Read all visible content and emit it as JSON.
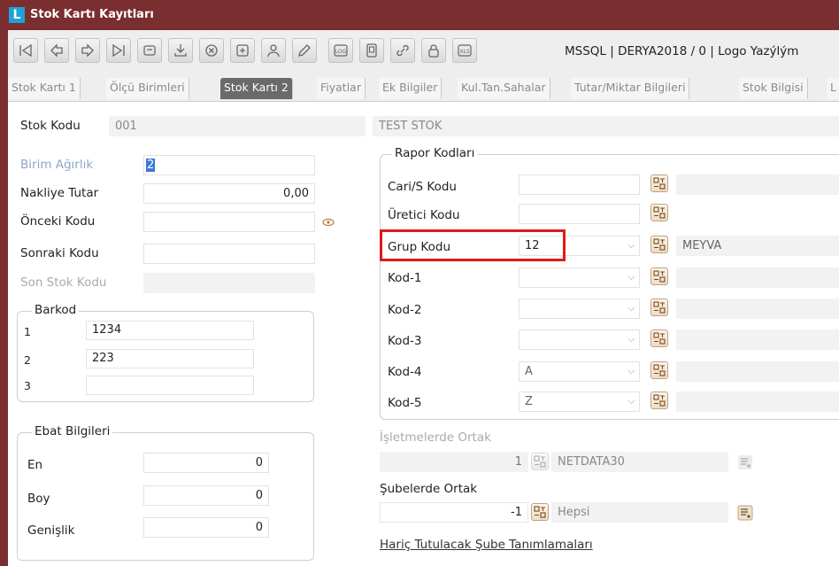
{
  "window": {
    "app_logo": "L",
    "title": "Stok Kartı Kayıtları"
  },
  "toolbar": {
    "connection_info": "MSSQL | DERYA2018 / 0 | Logo Yazýlým",
    "buttons": [
      {
        "icon": "first-record-icon"
      },
      {
        "icon": "previous-record-icon"
      },
      {
        "icon": "next-record-icon"
      },
      {
        "icon": "last-record-icon"
      },
      {
        "icon": "folder-icon"
      },
      {
        "icon": "download-icon"
      },
      {
        "icon": "delete-icon"
      },
      {
        "icon": "new-record-icon"
      },
      {
        "icon": "user-icon"
      },
      {
        "icon": "edit-icon"
      },
      {
        "icon": "log-icon",
        "label": "LOG"
      },
      {
        "icon": "document-icon"
      },
      {
        "icon": "link-icon"
      },
      {
        "icon": "lock-icon"
      },
      {
        "icon": "excel-icon",
        "label": "XLS"
      }
    ]
  },
  "tabs": [
    {
      "label": "Stok Kartı 1",
      "active": false
    },
    {
      "label": "Ölçü Birimleri",
      "active": false
    },
    {
      "label": "Stok Kartı 2",
      "active": true
    },
    {
      "label": "Fiyatlar",
      "active": false
    },
    {
      "label": "Ek Bilgiler",
      "active": false
    },
    {
      "label": "Kul.Tan.Sahalar",
      "active": false
    },
    {
      "label": "Tutar/Miktar Bilgileri",
      "active": false
    },
    {
      "label": "Stok Bilgisi",
      "active": false
    },
    {
      "label": "L",
      "active": false
    }
  ],
  "header": {
    "stok_kodu_label": "Stok Kodu",
    "stok_kodu_value": "001",
    "stok_adi_value": "TEST STOK"
  },
  "left": {
    "birim_agirlik": {
      "label": "Birim Ağırlık",
      "value": "2"
    },
    "nakliye_tutar": {
      "label": "Nakliye Tutar",
      "value": "0,00"
    },
    "onceki_kodu": {
      "label": "Önceki Kodu",
      "value": ""
    },
    "sonraki_kodu": {
      "label": "Sonraki Kodu",
      "value": ""
    },
    "son_stok_kodu": {
      "label": "Son Stok Kodu",
      "value": ""
    },
    "barkod": {
      "title": "Barkod",
      "rows": [
        {
          "no": "1",
          "value": "1234"
        },
        {
          "no": "2",
          "value": "223"
        },
        {
          "no": "3",
          "value": ""
        }
      ]
    },
    "ebat": {
      "title": "Ebat Bilgileri",
      "rows": [
        {
          "label": "En",
          "value": "0"
        },
        {
          "label": "Boy",
          "value": "0"
        },
        {
          "label": "Genişlik",
          "value": "0"
        }
      ]
    }
  },
  "right": {
    "rapor_kodlari_title": "Rapor Kodları",
    "rows": [
      {
        "label": "Cari/S Kodu",
        "value": "",
        "combo": false,
        "desc": ""
      },
      {
        "label": "Üretici Kodu",
        "value": "",
        "combo": false,
        "desc": ""
      },
      {
        "label": "Grup Kodu",
        "value": "12",
        "combo": true,
        "desc": "MEYVA"
      },
      {
        "label": "Kod-1",
        "value": "",
        "combo": true,
        "desc": ""
      },
      {
        "label": "Kod-2",
        "value": "",
        "combo": true,
        "desc": ""
      },
      {
        "label": "Kod-3",
        "value": "",
        "combo": true,
        "desc": ""
      },
      {
        "label": "Kod-4",
        "value": "A",
        "combo": true,
        "desc": ""
      },
      {
        "label": "Kod-5",
        "value": "Z",
        "combo": true,
        "desc": ""
      }
    ],
    "isletmelerde_ortak": {
      "label": "İşletmelerde Ortak",
      "value": "1",
      "desc": "NETDATA30"
    },
    "subelerde_ortak": {
      "label": "Şubelerde Ortak",
      "value": "-1",
      "desc": "Hepsi"
    },
    "haric_link": "Hariç Tutulacak Şube Tanımlamaları"
  },
  "colors": {
    "titlebar": "#7b2e2f",
    "highlight": "#e0181a",
    "logo": "#1fa2d6"
  }
}
